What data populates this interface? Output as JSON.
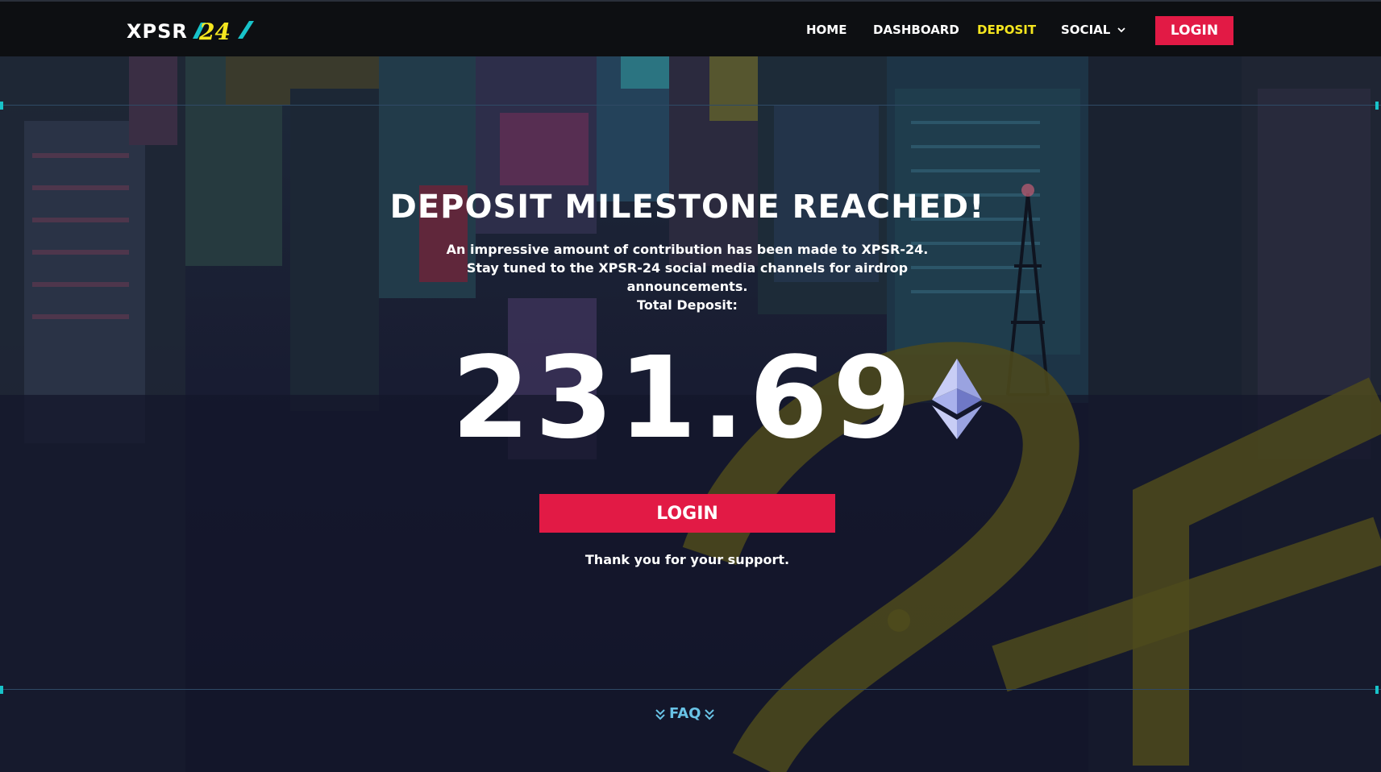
{
  "brand": {
    "name": "XPSR",
    "mark": "24"
  },
  "nav": {
    "items": [
      {
        "label": "HOME",
        "active": false
      },
      {
        "label": "DASHBOARD",
        "active": false
      },
      {
        "label": "DEPOSIT",
        "active": true
      },
      {
        "label": "SOCIAL",
        "active": false
      }
    ],
    "login_label": "LOGIN"
  },
  "hero": {
    "headline": "DEPOSIT MILESTONE REACHED!",
    "subtext": "An impressive amount of contribution has been made to XPSR-24. Stay tuned to the XPSR-24 social media channels for airdrop announcements.",
    "total_label": "Total Deposit:",
    "total_value": "231.69",
    "currency_icon": "ethereum-icon",
    "login_label": "LOGIN",
    "thanks": "Thank you for your support."
  },
  "footer": {
    "faq_label": "FAQ"
  },
  "colors": {
    "accent": "#e21a45",
    "active_nav": "#f5e61f",
    "faq": "#69c3e6",
    "navbar_bg": "#0d0f12",
    "decor_yellow": "#4d4a1c"
  }
}
